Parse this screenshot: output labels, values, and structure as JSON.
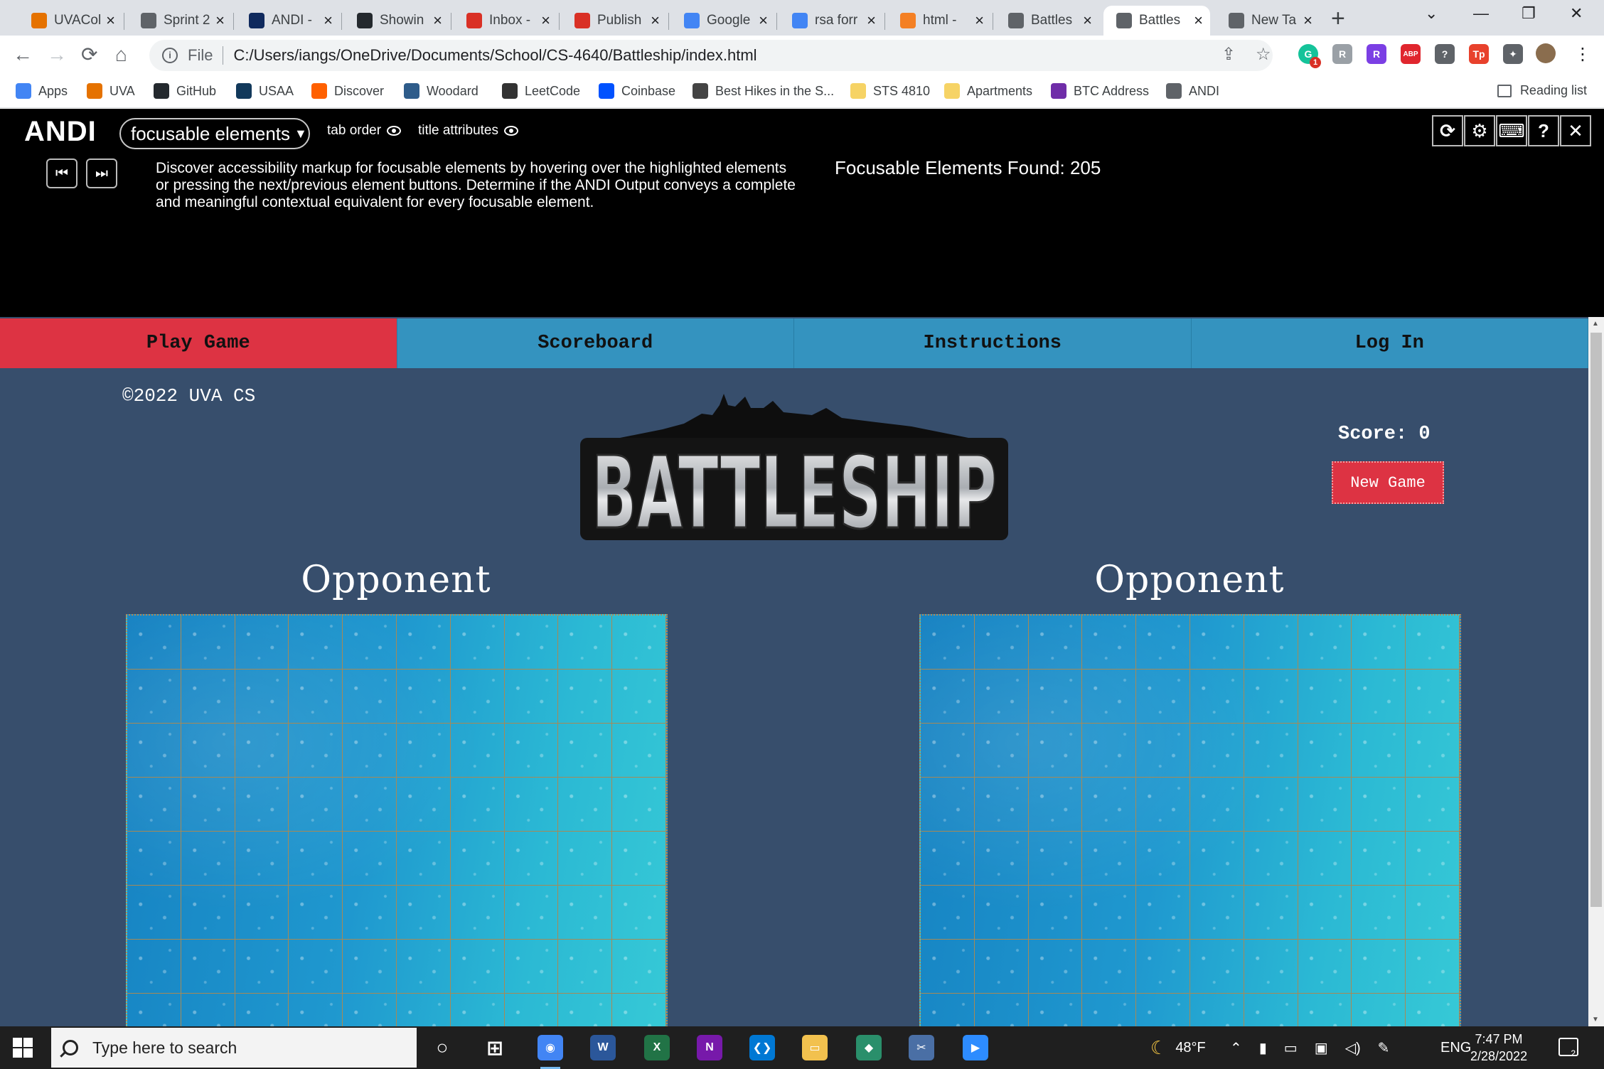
{
  "browser": {
    "tabs": [
      {
        "title": "UVACol",
        "icon": "uvacollab-icon",
        "color": "#e57200"
      },
      {
        "title": "Sprint 2",
        "icon": "globe-icon",
        "color": "#5f6368"
      },
      {
        "title": "ANDI -",
        "icon": "ssa-icon",
        "color": "#102a5e"
      },
      {
        "title": "Showin",
        "icon": "github-icon",
        "color": "#24292e"
      },
      {
        "title": "Inbox -",
        "icon": "gmail-icon",
        "color": "#d93025"
      },
      {
        "title": "Publish",
        "icon": "gmail-icon",
        "color": "#d93025"
      },
      {
        "title": "Google",
        "icon": "calendar-icon",
        "color": "#4285f4"
      },
      {
        "title": "rsa forr",
        "icon": "google-icon",
        "color": "#4285f4"
      },
      {
        "title": "html -",
        "icon": "stackoverflow-icon",
        "color": "#f48024"
      },
      {
        "title": "Battles",
        "icon": "globe-icon",
        "color": "#5f6368"
      },
      {
        "title": "Battles",
        "icon": "globe-icon",
        "color": "#5f6368",
        "active": true
      },
      {
        "title": "New Ta",
        "icon": "chrome-icon",
        "color": "#5f6368"
      }
    ],
    "new_tab": "+",
    "window_controls": {
      "minimize": "—",
      "restore": "❐",
      "close": "✕",
      "tab_search": "⌄"
    },
    "address": {
      "scheme": "File",
      "url": "C:/Users/iangs/OneDrive/Documents/School/CS-4640/Battleship/index.html"
    },
    "extensions": [
      {
        "name": "grammarly-extension-icon",
        "label": "G",
        "color": "#15c39a"
      },
      {
        "name": "extension-r-gray-icon",
        "label": "R",
        "color": "#9aa0a6"
      },
      {
        "name": "extension-r-purple-icon",
        "label": "R",
        "color": "#7b3fe4"
      },
      {
        "name": "adblock-plus-icon",
        "label": "ABP",
        "color": "#e0262e"
      },
      {
        "name": "help-extension-icon",
        "label": "?",
        "color": "#5f6368"
      },
      {
        "name": "tp-extension-icon",
        "label": "Tp",
        "color": "#e8412c"
      },
      {
        "name": "puzzle-extensions-icon",
        "label": "✦",
        "color": "#5f6368"
      }
    ],
    "extension_badge": "1",
    "bookmarks": [
      {
        "label": "Apps",
        "icon": "apps-grid-icon",
        "color": "#4285f4"
      },
      {
        "label": "UVA",
        "icon": "uva-icon",
        "color": "#e57200"
      },
      {
        "label": "GitHub",
        "icon": "github-icon",
        "color": "#24292e"
      },
      {
        "label": "USAA",
        "icon": "usaa-icon",
        "color": "#12395b"
      },
      {
        "label": "Discover",
        "icon": "discover-icon",
        "color": "#ff6000"
      },
      {
        "label": "Woodard",
        "icon": "woodard-icon",
        "color": "#2e5c8a"
      },
      {
        "label": "LeetCode",
        "icon": "leetcode-icon",
        "color": "#333"
      },
      {
        "label": "Coinbase",
        "icon": "coinbase-icon",
        "color": "#0052ff"
      },
      {
        "label": "Best Hikes in the S...",
        "icon": "hikes-icon",
        "color": "#444"
      },
      {
        "label": "STS 4810",
        "icon": "folder-icon",
        "color": "#f6d365"
      },
      {
        "label": "Apartments",
        "icon": "folder-icon",
        "color": "#f6d365"
      },
      {
        "label": "BTC Address",
        "icon": "btc-icon",
        "color": "#6f2da8"
      },
      {
        "label": "ANDI",
        "icon": "globe-icon",
        "color": "#5f6368"
      }
    ],
    "reading_list": "Reading list"
  },
  "andi": {
    "logo": "ANDI",
    "mode": "focusable elements",
    "tab_order": "tab order",
    "title_attributes": "title attributes",
    "prev": "⏮",
    "next": "⏭",
    "description": "Discover accessibility markup for focusable elements by hovering over the highlighted elements or pressing the next/previous element buttons. Determine if the ANDI Output conveys a complete and meaningful contextual equivalent for every focusable element.",
    "found": "Focusable Elements Found: 205",
    "tools": [
      "⟳",
      "⚙",
      "⌨",
      "?",
      "✕"
    ]
  },
  "game": {
    "nav": [
      {
        "label": "Play Game",
        "active": true
      },
      {
        "label": "Scoreboard"
      },
      {
        "label": "Instructions"
      },
      {
        "label": "Log In"
      }
    ],
    "copyright": "©2022 UVA CS",
    "logo_text": "BATTLESHIP",
    "score_label": "Score: 0",
    "new_game": "New Game",
    "boards": [
      {
        "title": "Opponent"
      },
      {
        "title": "Opponent"
      }
    ]
  },
  "taskbar": {
    "search_placeholder": "Type here to search",
    "weather": "48°F",
    "language": "ENG",
    "time": "7:47 PM",
    "date": "2/28/2022",
    "notifications": "2",
    "apps": [
      {
        "name": "task-view-icon",
        "label": "○",
        "color": "transparent"
      },
      {
        "name": "widgets-icon",
        "label": "⊞",
        "color": "transparent"
      },
      {
        "name": "chrome-taskbar-icon",
        "label": "◉",
        "color": "#4285f4",
        "running": true
      },
      {
        "name": "word-icon",
        "label": "W",
        "color": "#2b579a"
      },
      {
        "name": "excel-icon",
        "label": "X",
        "color": "#217346"
      },
      {
        "name": "onenote-icon",
        "label": "N",
        "color": "#7719aa"
      },
      {
        "name": "vscode-icon",
        "label": "❮❯",
        "color": "#0078d4"
      },
      {
        "name": "file-explorer-icon",
        "label": "▭",
        "color": "#f2c14e"
      },
      {
        "name": "git-icon",
        "label": "◆",
        "color": "#2a8f6b"
      },
      {
        "name": "snipping-tool-icon",
        "label": "✂",
        "color": "#4a6fa5"
      },
      {
        "name": "zoom-icon",
        "label": "▶",
        "color": "#2d8cff"
      }
    ]
  }
}
